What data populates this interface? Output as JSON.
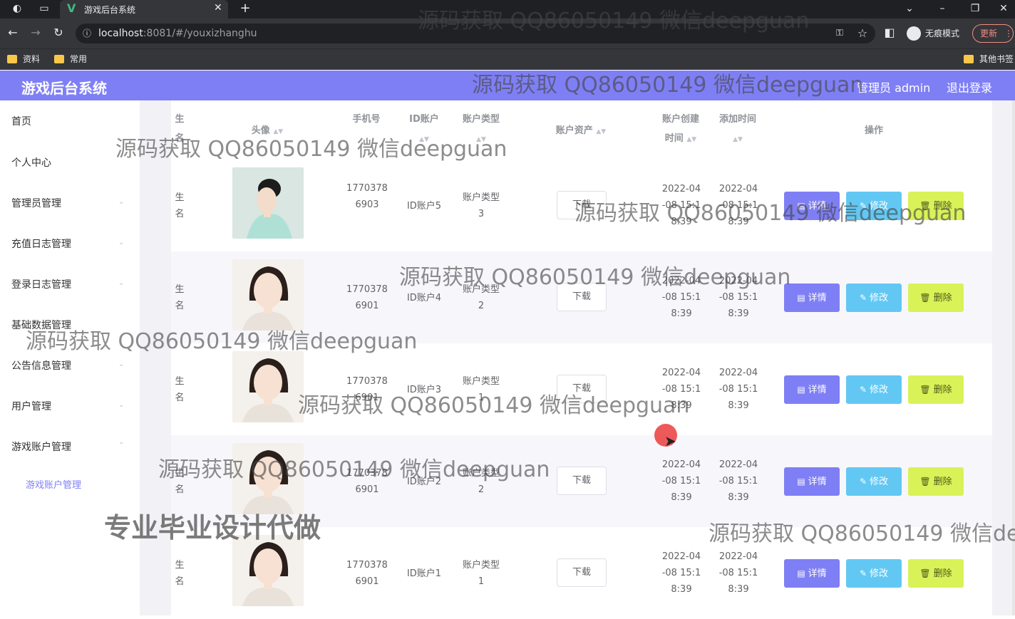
{
  "browser": {
    "tab_title": "游戏后台系统",
    "url_host": "localhost",
    "url_rest": ":8081/#/youxizhanghu",
    "incognito_label": "无痕模式",
    "update_label": "更新",
    "bookmarks": [
      "资料",
      "常用"
    ],
    "other_bookmarks": "其他书签"
  },
  "header": {
    "title": "游戏后台系统",
    "admin_label": "管理员 admin",
    "logout_label": "退出登录",
    "accent_color": "#7f7ff5"
  },
  "sidebar": {
    "items": [
      {
        "label": "首页"
      },
      {
        "label": "个人中心"
      },
      {
        "label": "管理员管理"
      },
      {
        "label": "充值日志管理"
      },
      {
        "label": "登录日志管理"
      },
      {
        "label": "基础数据管理"
      },
      {
        "label": "公告信息管理"
      },
      {
        "label": "用户管理"
      },
      {
        "label": "游戏账户管理"
      }
    ],
    "sub_item": "游戏账户管理"
  },
  "table": {
    "headers": {
      "name": "生名",
      "avatar": "头像",
      "phone": "手机号",
      "id_account": "ID账户",
      "account_type": "账户类型",
      "assets": "账户资产",
      "created_1": "账户创建",
      "created_2": "时间",
      "added": "添加时间",
      "ops": "操作"
    },
    "rows": [
      {
        "name": "生名",
        "phone_1": "1770378",
        "phone_2": "6903",
        "id": "ID账户5",
        "type_1": "账户类型",
        "type_2": "3",
        "download": "下载",
        "c1": "2022-04",
        "c2": "-08 15:1",
        "c3": "8:39",
        "a1": "2022-04",
        "a2": "-08 15:1",
        "a3": "8:39"
      },
      {
        "name": "生名",
        "phone_1": "1770378",
        "phone_2": "6901",
        "id": "ID账户4",
        "type_1": "账户类型",
        "type_2": "2",
        "download": "下载",
        "c1": "2022-04",
        "c2": "-08 15:1",
        "c3": "8:39",
        "a1": "2022-04",
        "a2": "-08 15:1",
        "a3": "8:39"
      },
      {
        "name": "生名",
        "phone_1": "1770378",
        "phone_2": "6901",
        "id": "ID账户3",
        "type_1": "账户类型",
        "type_2": "1",
        "download": "下载",
        "c1": "2022-04",
        "c2": "-08 15:1",
        "c3": "8:39",
        "a1": "2022-04",
        "a2": "-08 15:1",
        "a3": "8:39"
      },
      {
        "name": "生名",
        "phone_1": "1770378",
        "phone_2": "6901",
        "id": "ID账户2",
        "type_1": "账户类型",
        "type_2": "2",
        "download": "下载",
        "c1": "2022-04",
        "c2": "-08 15:1",
        "c3": "8:39",
        "a1": "2022-04",
        "a2": "-08 15:1",
        "a3": "8:39"
      },
      {
        "name": "生名",
        "phone_1": "1770378",
        "phone_2": "6901",
        "id": "ID账户1",
        "type_1": "账户类型",
        "type_2": "1",
        "download": "下载",
        "c1": "2022-04",
        "c2": "-08 15:1",
        "c3": "8:39",
        "a1": "2022-04",
        "a2": "-08 15:1",
        "a3": "8:39"
      }
    ],
    "btn_detail": "详情",
    "btn_edit": "修改",
    "btn_delete": "删除"
  },
  "watermark": {
    "text": "源码获取 QQ86050149 微信deepguan",
    "big_text": "专业毕业设计代做"
  }
}
